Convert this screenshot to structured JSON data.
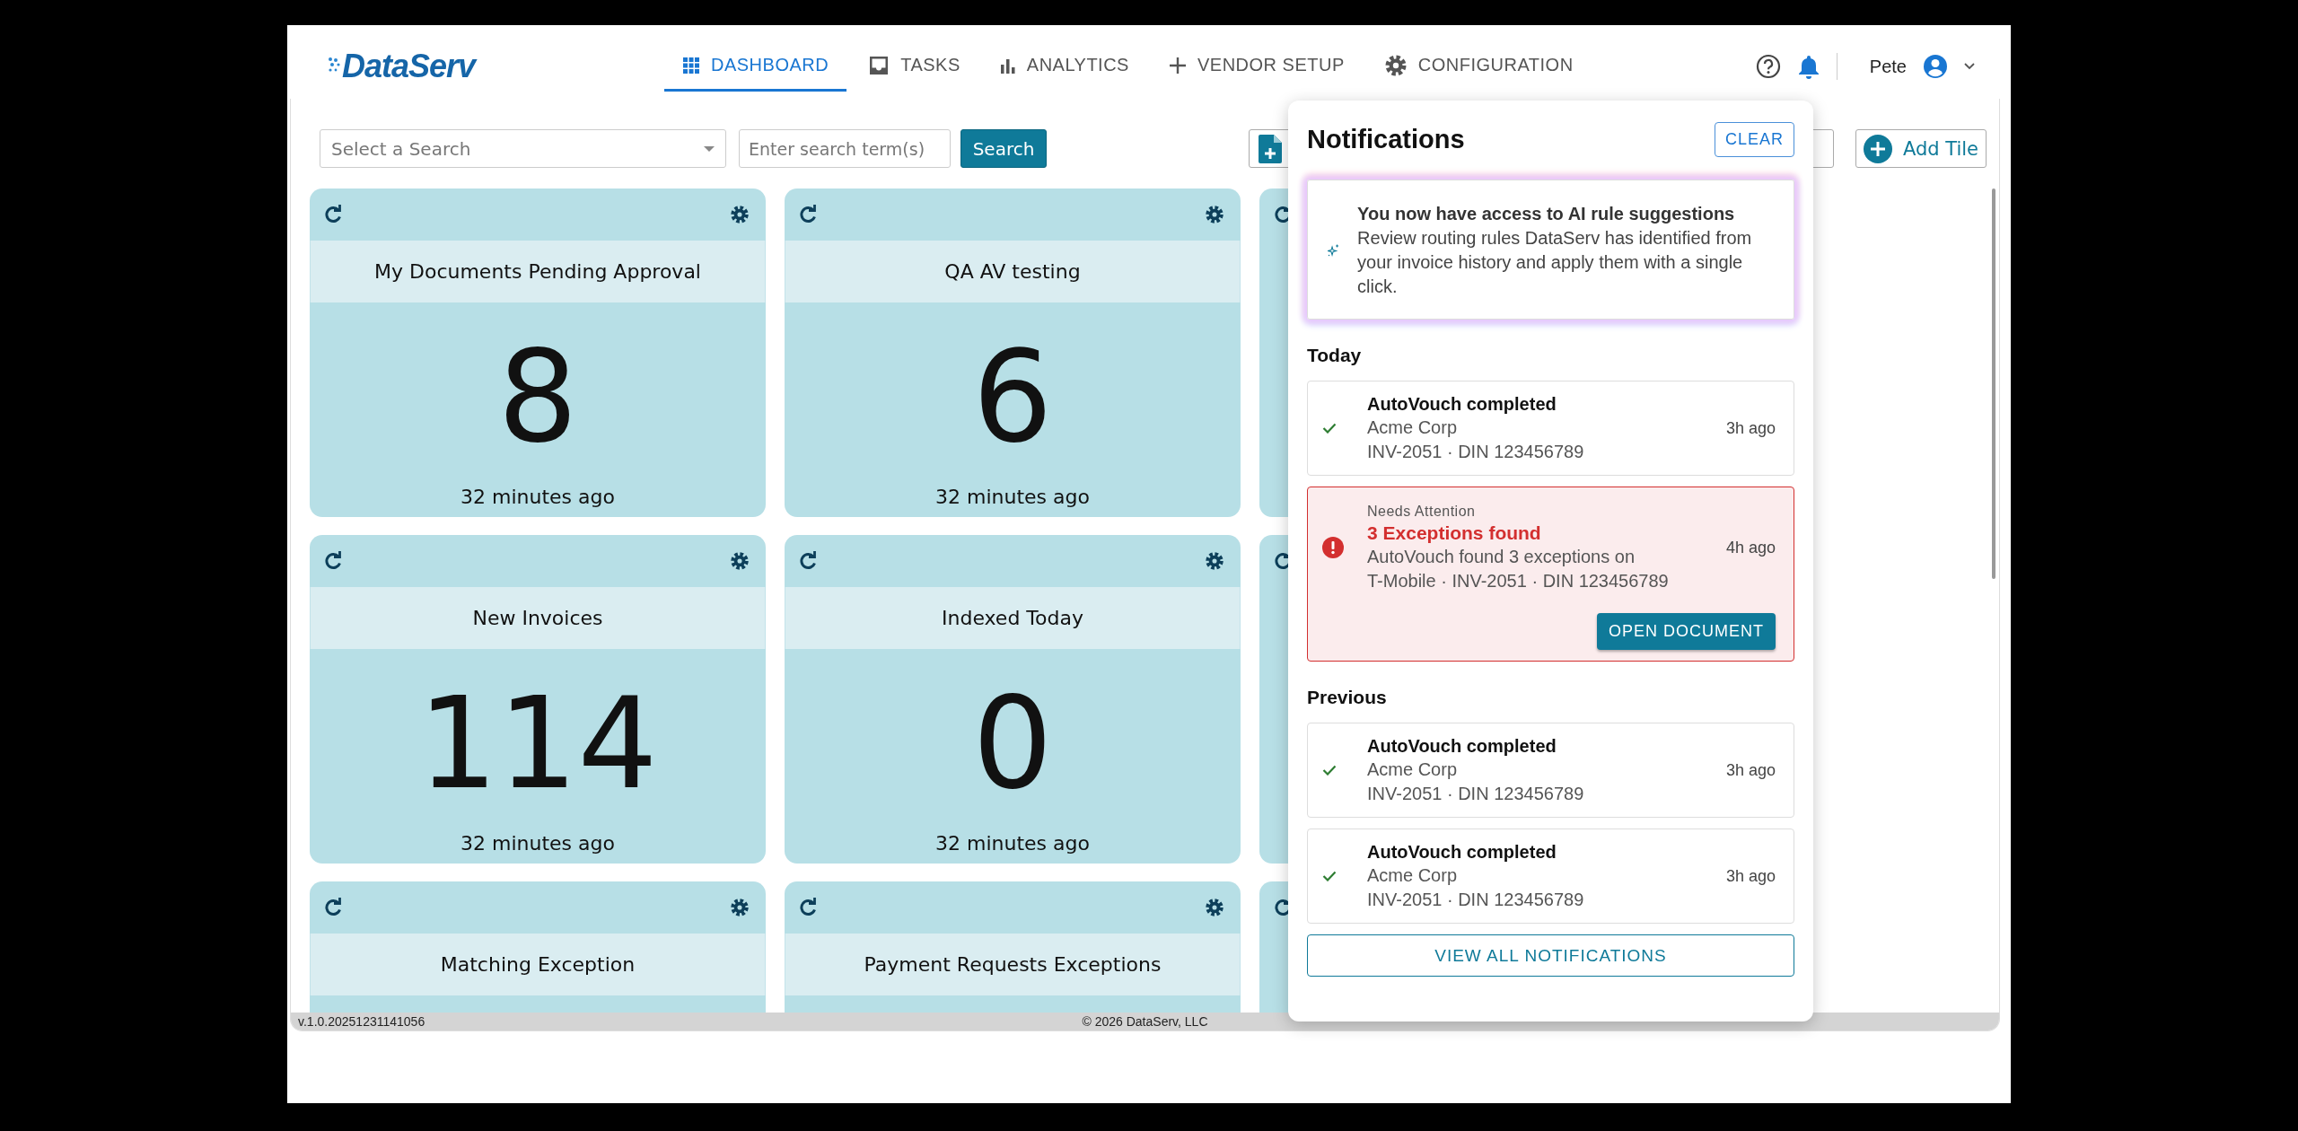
{
  "header": {
    "logo": "DataServ",
    "nav": [
      {
        "label": "DASHBOARD",
        "selected": true
      },
      {
        "label": "TASKS",
        "selected": false
      },
      {
        "label": "ANALYTICS",
        "selected": false
      },
      {
        "label": "VENDOR SETUP",
        "selected": false
      },
      {
        "label": "CONFIGURATION",
        "selected": false
      }
    ],
    "user": "Pete"
  },
  "toolbar": {
    "search_select": {
      "placeholder": "Select a Search"
    },
    "search_input": {
      "placeholder": "Enter search term(s)"
    },
    "search_button": "Search",
    "add_tile": "Add Tile"
  },
  "tiles": [
    {
      "kind": "metric",
      "title": "My Documents Pending Approval",
      "count": "8",
      "updated": "32 minutes ago"
    },
    {
      "kind": "metric",
      "title": "QA AV testing",
      "count": "6",
      "updated": "32 minutes ago"
    },
    {
      "kind": "covered"
    },
    {
      "kind": "metric",
      "title": "New Invoices",
      "count": "114",
      "updated": "32 minutes ago"
    },
    {
      "kind": "metric",
      "title": "Indexed Today",
      "count": "0",
      "updated": "32 minutes ago"
    },
    {
      "kind": "covered"
    },
    {
      "kind": "metric",
      "title": "Matching Exception"
    },
    {
      "kind": "metric",
      "title": "Payment Requests Exceptions"
    },
    {
      "kind": "covered"
    }
  ],
  "notifications": {
    "title": "Notifications",
    "clear": "CLEAR",
    "promo": {
      "title": "You now have access to AI rule suggestions",
      "text": "Review routing rules DataServ has identified from your invoice history and apply them with a single click."
    },
    "sections": [
      {
        "heading": "Today",
        "items": [
          {
            "kind": "success",
            "title": "AutoVouch completed",
            "lines": [
              "Acme Corp",
              "INV-2051 · DIN 123456789"
            ],
            "time": "3h ago"
          },
          {
            "kind": "alert",
            "label": "Needs Attention",
            "title": "3 Exceptions found",
            "lines": [
              "AutoVouch found 3 exceptions on",
              "T-Mobile · INV-2051 · DIN 123456789"
            ],
            "time": "4h ago",
            "action": "OPEN DOCUMENT"
          }
        ]
      },
      {
        "heading": "Previous",
        "items": [
          {
            "kind": "success",
            "title": "AutoVouch completed",
            "lines": [
              "Acme Corp",
              "INV-2051 · DIN 123456789"
            ],
            "time": "3h ago"
          },
          {
            "kind": "success",
            "title": "AutoVouch completed",
            "lines": [
              "Acme Corp",
              "INV-2051 · DIN 123456789"
            ],
            "time": "3h ago"
          }
        ]
      }
    ],
    "view_all": "VIEW ALL NOTIFICATIONS"
  },
  "footer": {
    "version": "v.1.0.20251231141056",
    "copyright": "© 2026 DataServ, LLC"
  }
}
